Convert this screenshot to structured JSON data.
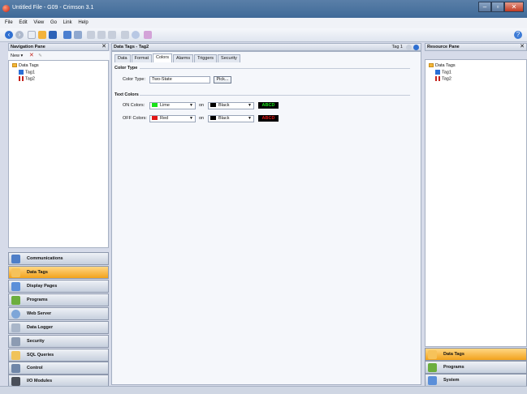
{
  "window": {
    "title": "Untitled File - G09 - Crimson 3.1",
    "controls": [
      "–",
      "▫",
      "✕"
    ]
  },
  "menu": [
    "File",
    "Edit",
    "View",
    "Go",
    "Link",
    "Help"
  ],
  "nav_pane": {
    "title": "Navigation Pane",
    "tools": {
      "new_label": "New"
    },
    "tree": {
      "root": "Data Tags",
      "items": [
        "Tag1",
        "Tag2"
      ]
    },
    "buttons": [
      {
        "label": "Communications",
        "active": false
      },
      {
        "label": "Data Tags",
        "active": true
      },
      {
        "label": "Display Pages",
        "active": false
      },
      {
        "label": "Programs",
        "active": false
      },
      {
        "label": "Web Server",
        "active": false
      },
      {
        "label": "Data Logger",
        "active": false
      },
      {
        "label": "Security",
        "active": false
      },
      {
        "label": "SQL Queries",
        "active": false
      },
      {
        "label": "Control",
        "active": false
      },
      {
        "label": "I/O Modules",
        "active": false
      }
    ]
  },
  "editor": {
    "title": "Data Tags - Tag2",
    "tag_indicator": "Tag 1",
    "tabs": [
      {
        "label": "Data",
        "active": false
      },
      {
        "label": "Format",
        "active": false
      },
      {
        "label": "Colors",
        "active": true
      },
      {
        "label": "Alarms",
        "active": false
      },
      {
        "label": "Triggers",
        "active": false
      },
      {
        "label": "Security",
        "active": false
      }
    ],
    "color_type": {
      "section": "Color Type",
      "label": "Color Type:",
      "value": "Two-State",
      "pick_button": "Pick..."
    },
    "text_colors": {
      "section": "Text Colors",
      "on_word": "on",
      "rows": [
        {
          "label": "ON Colors:",
          "fg": "Lime",
          "fg_color": "#19e319",
          "bg": "Black",
          "bg_color": "#000000",
          "sample": "ABCD",
          "sample_fg": "#19e319"
        },
        {
          "label": "OFF Colors:",
          "fg": "Red",
          "fg_color": "#e01616",
          "bg": "Black",
          "bg_color": "#000000",
          "sample": "ABCD",
          "sample_fg": "#e01616"
        }
      ]
    }
  },
  "resource_pane": {
    "title": "Resource Pane",
    "tree": {
      "root": "Data Tags",
      "items": [
        "Tag1",
        "Tag2"
      ]
    },
    "buttons": [
      {
        "label": "Data Tags",
        "active": true
      },
      {
        "label": "Programs",
        "active": false
      },
      {
        "label": "System",
        "active": false
      }
    ]
  },
  "colors": {
    "accent_active": "#f2a21c",
    "titlebar": "#4a709c"
  }
}
